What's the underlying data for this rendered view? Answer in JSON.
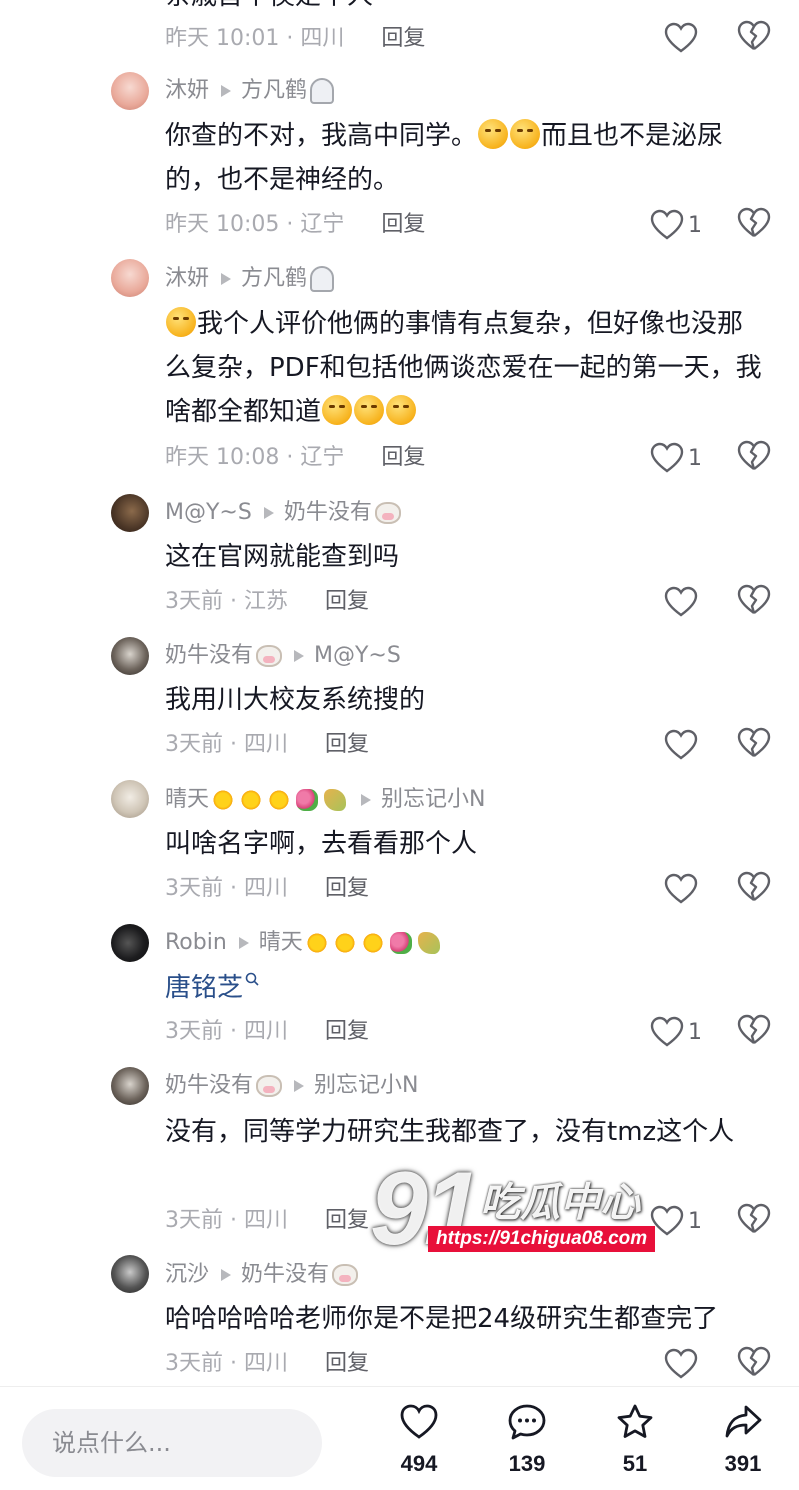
{
  "comments": [
    {
      "body_partial": "亲戚首个侯是个人",
      "time": "昨天 10:01 · 四川",
      "reply": "回复",
      "likes": ""
    },
    {
      "user": "沐妍",
      "reply_to": "方凡鹤",
      "body": "你查的不对，我高中同学。",
      "body_after": "而且也不是泌尿的，也不是神经的。",
      "time": "昨天 10:05 · 辽宁",
      "reply": "回复",
      "likes": "1"
    },
    {
      "user": "沐妍",
      "reply_to": "方凡鹤",
      "body": "我个人评价他俩的事情有点复杂，但好像也没那么复杂，PDF和包括他俩谈恋爱在一起的第一天，我啥都全都知道",
      "time": "昨天 10:08 · 辽宁",
      "reply": "回复",
      "likes": "1"
    },
    {
      "user": "M@Y~S",
      "reply_to": "奶牛没有",
      "body": "这在官网就能查到吗",
      "time": "3天前 · 江苏",
      "reply": "回复",
      "likes": ""
    },
    {
      "user": "奶牛没有",
      "reply_to": "M@Y~S",
      "body": "我用川大校友系统搜的",
      "time": "3天前 · 四川",
      "reply": "回复",
      "likes": ""
    },
    {
      "user": "晴天",
      "reply_to": "别忘记小N",
      "body": "叫啥名字啊，去看看那个人",
      "time": "3天前 · 四川",
      "reply": "回复",
      "likes": ""
    },
    {
      "user": "Robin",
      "reply_to": "晴天",
      "body": "唐铭芝",
      "time": "3天前 · 四川",
      "reply": "回复",
      "likes": "1"
    },
    {
      "user": "奶牛没有",
      "reply_to": "别忘记小N",
      "body": "没有，同等学力研究生我都查了，没有tmz这个人",
      "time": "3天前 · 四川",
      "reply": "回复",
      "likes": "1"
    },
    {
      "user": "沉沙",
      "reply_to": "奶牛没有",
      "body": "哈哈哈哈哈老师你是不是把24级研究生都查完了",
      "time": "3天前 · 四川",
      "reply": "回复",
      "likes": ""
    }
  ],
  "bottombar": {
    "placeholder": "说点什么...",
    "like_count": "494",
    "comment_count": "139",
    "star_count": "51",
    "share_count": "391"
  },
  "watermark": {
    "number": "91",
    "name": "吃瓜中心",
    "url": "https://91chigua08.com"
  },
  "colors": {
    "text": "#161823",
    "meta": "#a9aab0",
    "link": "#2a4f8a",
    "watermark_url_bg": "#e8103a"
  }
}
